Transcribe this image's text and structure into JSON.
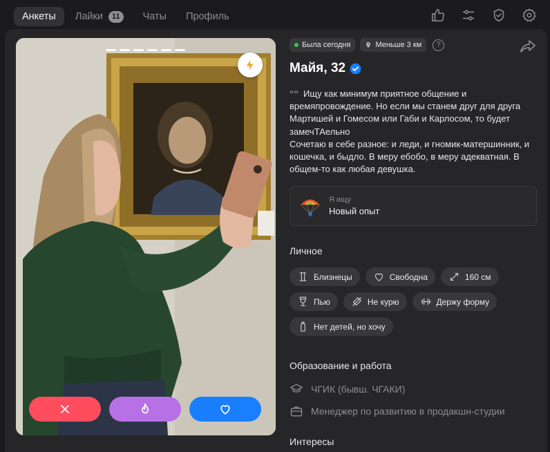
{
  "nav": {
    "tabs": [
      {
        "label": "Анкеты",
        "active": true
      },
      {
        "label": "Лайки",
        "badge": "11"
      },
      {
        "label": "Чаты"
      },
      {
        "label": "Профиль"
      }
    ],
    "icons": [
      "thumbs-up-icon",
      "sliders-icon",
      "shield-check-icon",
      "gear-icon"
    ]
  },
  "photo": {
    "story_count": 6,
    "boost_icon": "lightning-icon",
    "actions": [
      {
        "name": "dislike",
        "icon": "close-icon",
        "color": "#ff4d5e"
      },
      {
        "name": "superlike",
        "icon": "flame-icon",
        "color": "#b870e6"
      },
      {
        "name": "like",
        "icon": "heart-icon",
        "color": "#1a7fff"
      }
    ]
  },
  "status": {
    "last_seen": "Была сегодня",
    "distance": "Меньше 3 км",
    "help": "?"
  },
  "profile": {
    "name": "Майя, 32",
    "verified": true,
    "bio_lines": [
      "Ищу как минимум приятное общение и времяпровождение. Но если мы станем друг для друга Мартишей и Гомесом или Габи и Карлосом, то будет замечТАельно",
      "Сочетаю в себе разное: и леди, и гномик-матершинник, и кошечка, и быдло. В меру ебобо, в меру адекватная. В общем-то как любая девушка."
    ]
  },
  "seeking": {
    "label": "Я ищу",
    "value": "Новый опыт",
    "icon": "parachute-icon"
  },
  "personal": {
    "title": "Личное",
    "rows": [
      [
        {
          "icon": "gemini-icon",
          "label": "Близнецы"
        },
        {
          "icon": "heart-outline-icon",
          "label": "Свободна"
        },
        {
          "icon": "height-icon",
          "label": "160 см"
        }
      ],
      [
        {
          "icon": "wine-glass-icon",
          "label": "Пью"
        },
        {
          "icon": "no-smoking-icon",
          "label": "Не курю"
        },
        {
          "icon": "dumbbell-icon",
          "label": "Держу форму"
        }
      ],
      [
        {
          "icon": "baby-bottle-icon",
          "label": "Нет детей, но хочу"
        }
      ]
    ]
  },
  "work": {
    "title": "Образование и работа",
    "education": "ЧГИК (бывш. ЧГАКИ)",
    "job": "Менеджер по развитию в продакшн-студии"
  },
  "interests": {
    "title": "Интересы"
  },
  "colors": {
    "background": "#1b1b1d",
    "panel": "#262628",
    "chip": "#38383b",
    "online": "#34c759",
    "verified": "#1a7fff"
  }
}
